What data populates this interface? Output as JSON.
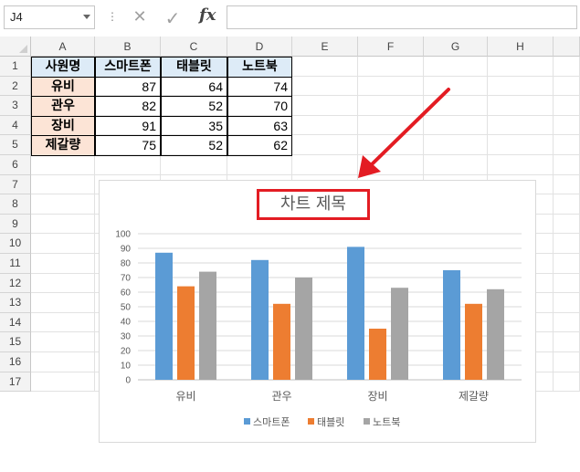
{
  "formula_bar": {
    "name_box": "J4",
    "dots": "⋮",
    "cancel_icon": "✕",
    "enter_icon": "✓",
    "fx_label": "fx",
    "formula": ""
  },
  "columns": [
    "A",
    "B",
    "C",
    "D",
    "E",
    "F",
    "G",
    "H"
  ],
  "rows": [
    "1",
    "2",
    "3",
    "4",
    "5",
    "6",
    "7",
    "8",
    "9",
    "10",
    "11",
    "12",
    "13",
    "14",
    "15",
    "16",
    "17"
  ],
  "table": {
    "headers": [
      "사원명",
      "스마트폰",
      "태블릿",
      "노트북"
    ],
    "rows": [
      {
        "name": "유비",
        "values": [
          "87",
          "64",
          "74"
        ]
      },
      {
        "name": "관우",
        "values": [
          "82",
          "52",
          "70"
        ]
      },
      {
        "name": "장비",
        "values": [
          "91",
          "35",
          "63"
        ]
      },
      {
        "name": "제갈량",
        "values": [
          "75",
          "52",
          "62"
        ]
      }
    ]
  },
  "colors": {
    "header_fill": "#ddebf7",
    "name_fill": "#fce4d6",
    "series_1": "#5b9bd5",
    "series_2": "#ed7d31",
    "series_3": "#a5a5a5",
    "annotation": "#e31c23"
  },
  "chart_data": {
    "type": "bar",
    "title": "차트 제목",
    "categories": [
      "유비",
      "관우",
      "장비",
      "제갈량"
    ],
    "series": [
      {
        "name": "스마트폰",
        "values": [
          87,
          82,
          91,
          75
        ]
      },
      {
        "name": "태블릿",
        "values": [
          64,
          52,
          35,
          52
        ]
      },
      {
        "name": "노트북",
        "values": [
          74,
          70,
          63,
          62
        ]
      }
    ],
    "ylim": [
      0,
      100
    ],
    "yticks": [
      "0",
      "10",
      "20",
      "30",
      "40",
      "50",
      "60",
      "70",
      "80",
      "90",
      "100"
    ],
    "grid": true,
    "legend_position": "bottom"
  }
}
